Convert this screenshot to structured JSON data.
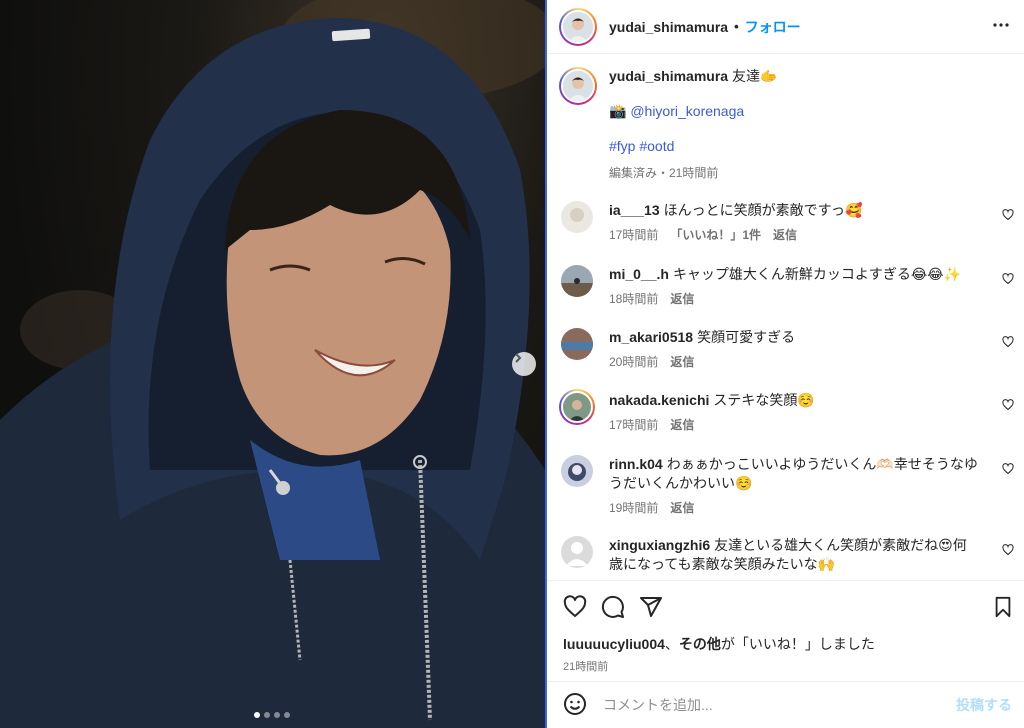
{
  "post": {
    "username": "yudai_shimamura",
    "follow_label": "フォロー",
    "separator": "•",
    "slide_count": 4,
    "active_slide": 1
  },
  "caption": {
    "username": "yudai_shimamura",
    "text": "友達🫱",
    "photo_credit_emoji": "📸",
    "mention": "@hiyori_korenaga",
    "hashtags": "#fyp #ootd",
    "meta": "編集済み・21時間前"
  },
  "comments": [
    {
      "username": "ia___13",
      "text": "ほんっとに笑顔が素敵ですっ🥰",
      "time": "17時間前",
      "likes": "「いいね！」1件",
      "reply": "返信",
      "avatar_color": "#e8e6e0"
    },
    {
      "username": "mi_0__.h",
      "text": "キャップ雄大くん新鮮カッコよすぎる😂😂✨",
      "time": "18時間前",
      "likes": "",
      "reply": "返信",
      "avatar_color": "#6f7f8e"
    },
    {
      "username": "m_akari0518",
      "text": "笑顔可愛すぎる",
      "time": "20時間前",
      "likes": "",
      "reply": "返信",
      "avatar_color": "#8a6a5c"
    },
    {
      "username": "nakada.kenichi",
      "text": "ステキな笑顔☺️",
      "time": "17時間前",
      "likes": "",
      "reply": "返信",
      "avatar_color": "#5d7a6b"
    },
    {
      "username": "rinn.k04",
      "text": "わぁぁかっこいいよゆうだいくん🫶🏻幸せそうなゆうだいくんかわいい☺️",
      "time": "19時間前",
      "likes": "",
      "reply": "返信",
      "avatar_color": "#3f4a6a"
    },
    {
      "username": "xinguxiangzhi6",
      "text": "友達といる雄大くん笑顔が素敵だね😍何歳になっても素敵な笑顔みたいな🙌",
      "time": "",
      "likes": "",
      "reply": "",
      "avatar_color": "#dbdbdb"
    }
  ],
  "liked_by": {
    "user": "luuuuucyliu004",
    "others": "その他",
    "suffix": "が「いいね！」しました",
    "separator": "、",
    "time": "21時間前"
  },
  "add_comment": {
    "placeholder": "コメントを追加...",
    "post_label": "投稿する"
  },
  "colors": {
    "link": "#0095f6",
    "mention": "#3b5bdb",
    "divider": "#3b63e8",
    "muted": "#737373"
  },
  "icons": [
    "more-icon",
    "heart-icon",
    "comment-icon",
    "share-icon",
    "bookmark-icon",
    "emoji-icon",
    "chevron-right-icon"
  ]
}
